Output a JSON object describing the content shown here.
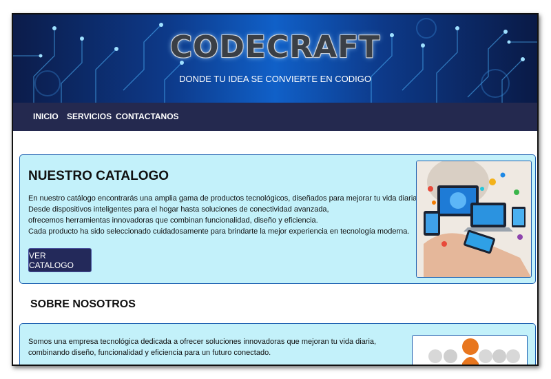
{
  "header": {
    "brand": "CODECRAFT",
    "slogan": "DONDE TU IDEA SE CONVIERTE EN CODIGO"
  },
  "nav": {
    "items": [
      "INICIO",
      "SERVICIOS",
      "CONTACTANOS"
    ]
  },
  "catalog": {
    "title": "NUESTRO CATALOGO",
    "lines": [
      "En nuestro catálogo encontrarás una amplia gama de productos tecnológicos, diseñados para mejorar tu vida diaria.",
      "Desde dispositivos inteligentes para el hogar hasta soluciones de conectividad avanzada,",
      "ofrecemos herramientas innovadoras que combinan funcionalidad, diseño y eficiencia.",
      "Cada producto ha sido seleccionado cuidadosamente para brindarte la mejor experiencia en tecnología moderna."
    ],
    "button_label": "VER CATALOGO"
  },
  "about": {
    "title": "SOBRE NOSOTROS",
    "lines": [
      "Somos una empresa tecnológica dedicada a ofrecer soluciones innovadoras que mejoran tu vida diaria,",
      "combinando diseño, funcionalidad y eficiencia para un futuro conectado."
    ]
  },
  "colors": {
    "nav_bg": "#24294f",
    "card_bg": "#c3f1fa",
    "card_border": "#1b5fb0",
    "button_bg": "#23295a",
    "accent_orange": "#e8761e"
  }
}
